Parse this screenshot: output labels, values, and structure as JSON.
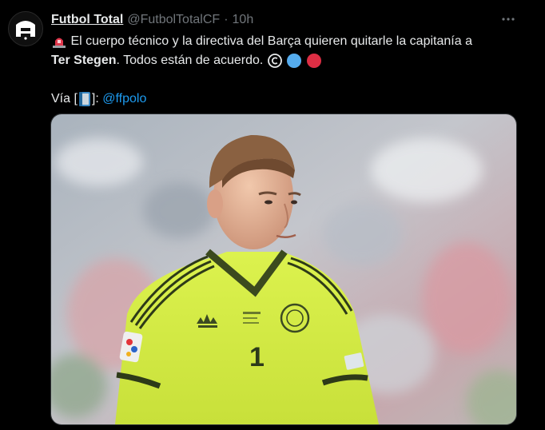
{
  "tweet": {
    "author_name": "Futbol Total",
    "handle": "@FutbolTotalCF",
    "separator": "·",
    "time": "10h",
    "text_part1": "El cuerpo técnico y la directiva del Barça quieren quitarle la capitanía a",
    "text_bold": "Ter Stegen",
    "text_part2": ". Todos están de acuerdo.",
    "via_label": "Vía [",
    "via_close": "]: ",
    "mention": "@ffpolo",
    "jersey_number": "1"
  },
  "icons": {
    "avatar": "futbol-total-logo",
    "more": "more-options-icon",
    "siren": "police-light-emoji",
    "copyright": "copyright-emoji",
    "blue_circle": "blue-circle-emoji",
    "red_circle": "red-circle-emoji",
    "book": "blue-book-emoji"
  },
  "colors": {
    "background": "#000000",
    "text": "#e7e9ea",
    "secondary": "#71767b",
    "link": "#1d9bf0",
    "jersey": "#d4f03a"
  }
}
